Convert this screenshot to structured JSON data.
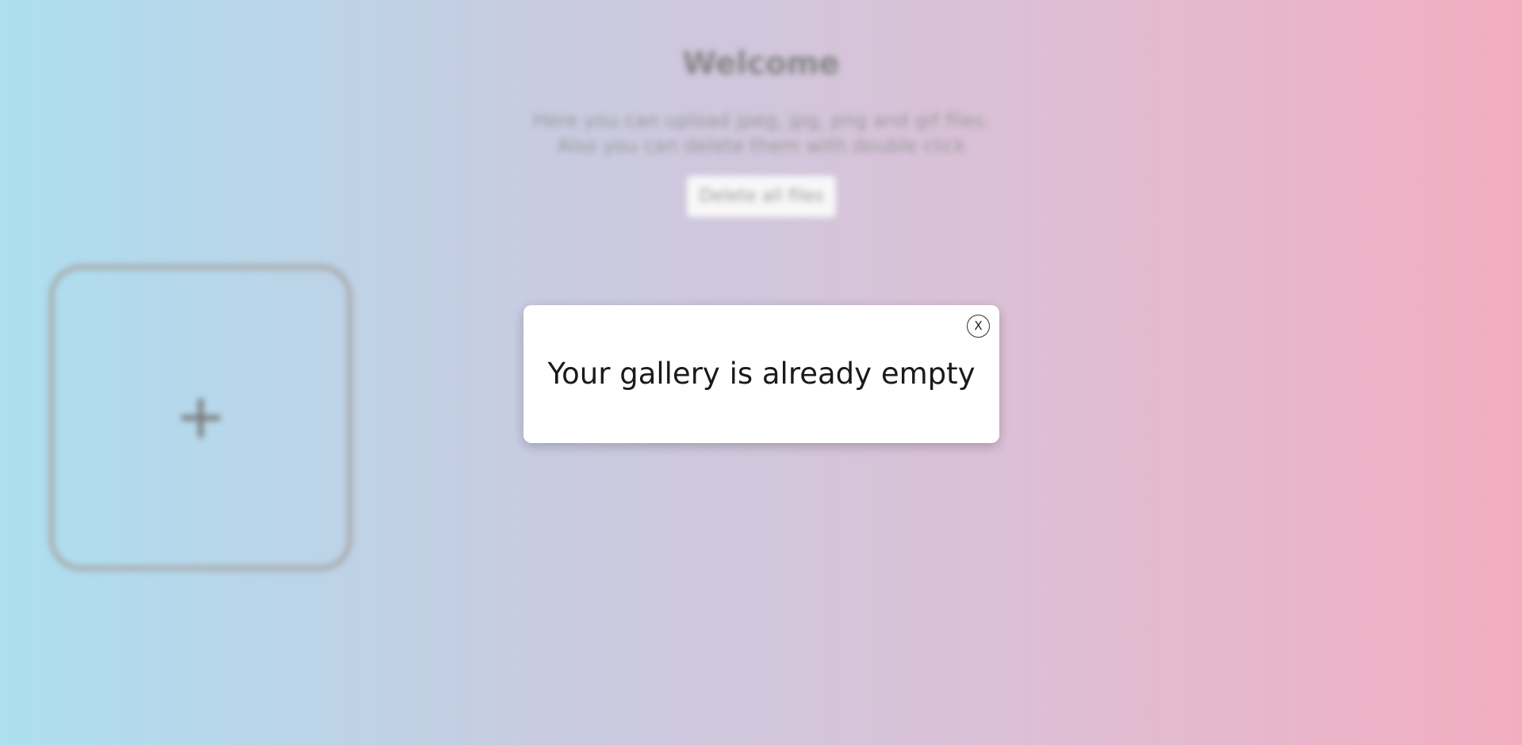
{
  "header": {
    "title": "Welcome",
    "description": "Here you can upload jpeg, jpg, png and gif files. Also you can delete them with double click",
    "delete_all_label": "Delete all files"
  },
  "gallery": {
    "add_tile_icon": "+"
  },
  "modal": {
    "message": "Your gallery is already empty",
    "close_label": "X"
  },
  "colors": {
    "gradient_start": "#acdff0",
    "gradient_end": "#f3adc1",
    "modal_background": "#ffffff"
  }
}
